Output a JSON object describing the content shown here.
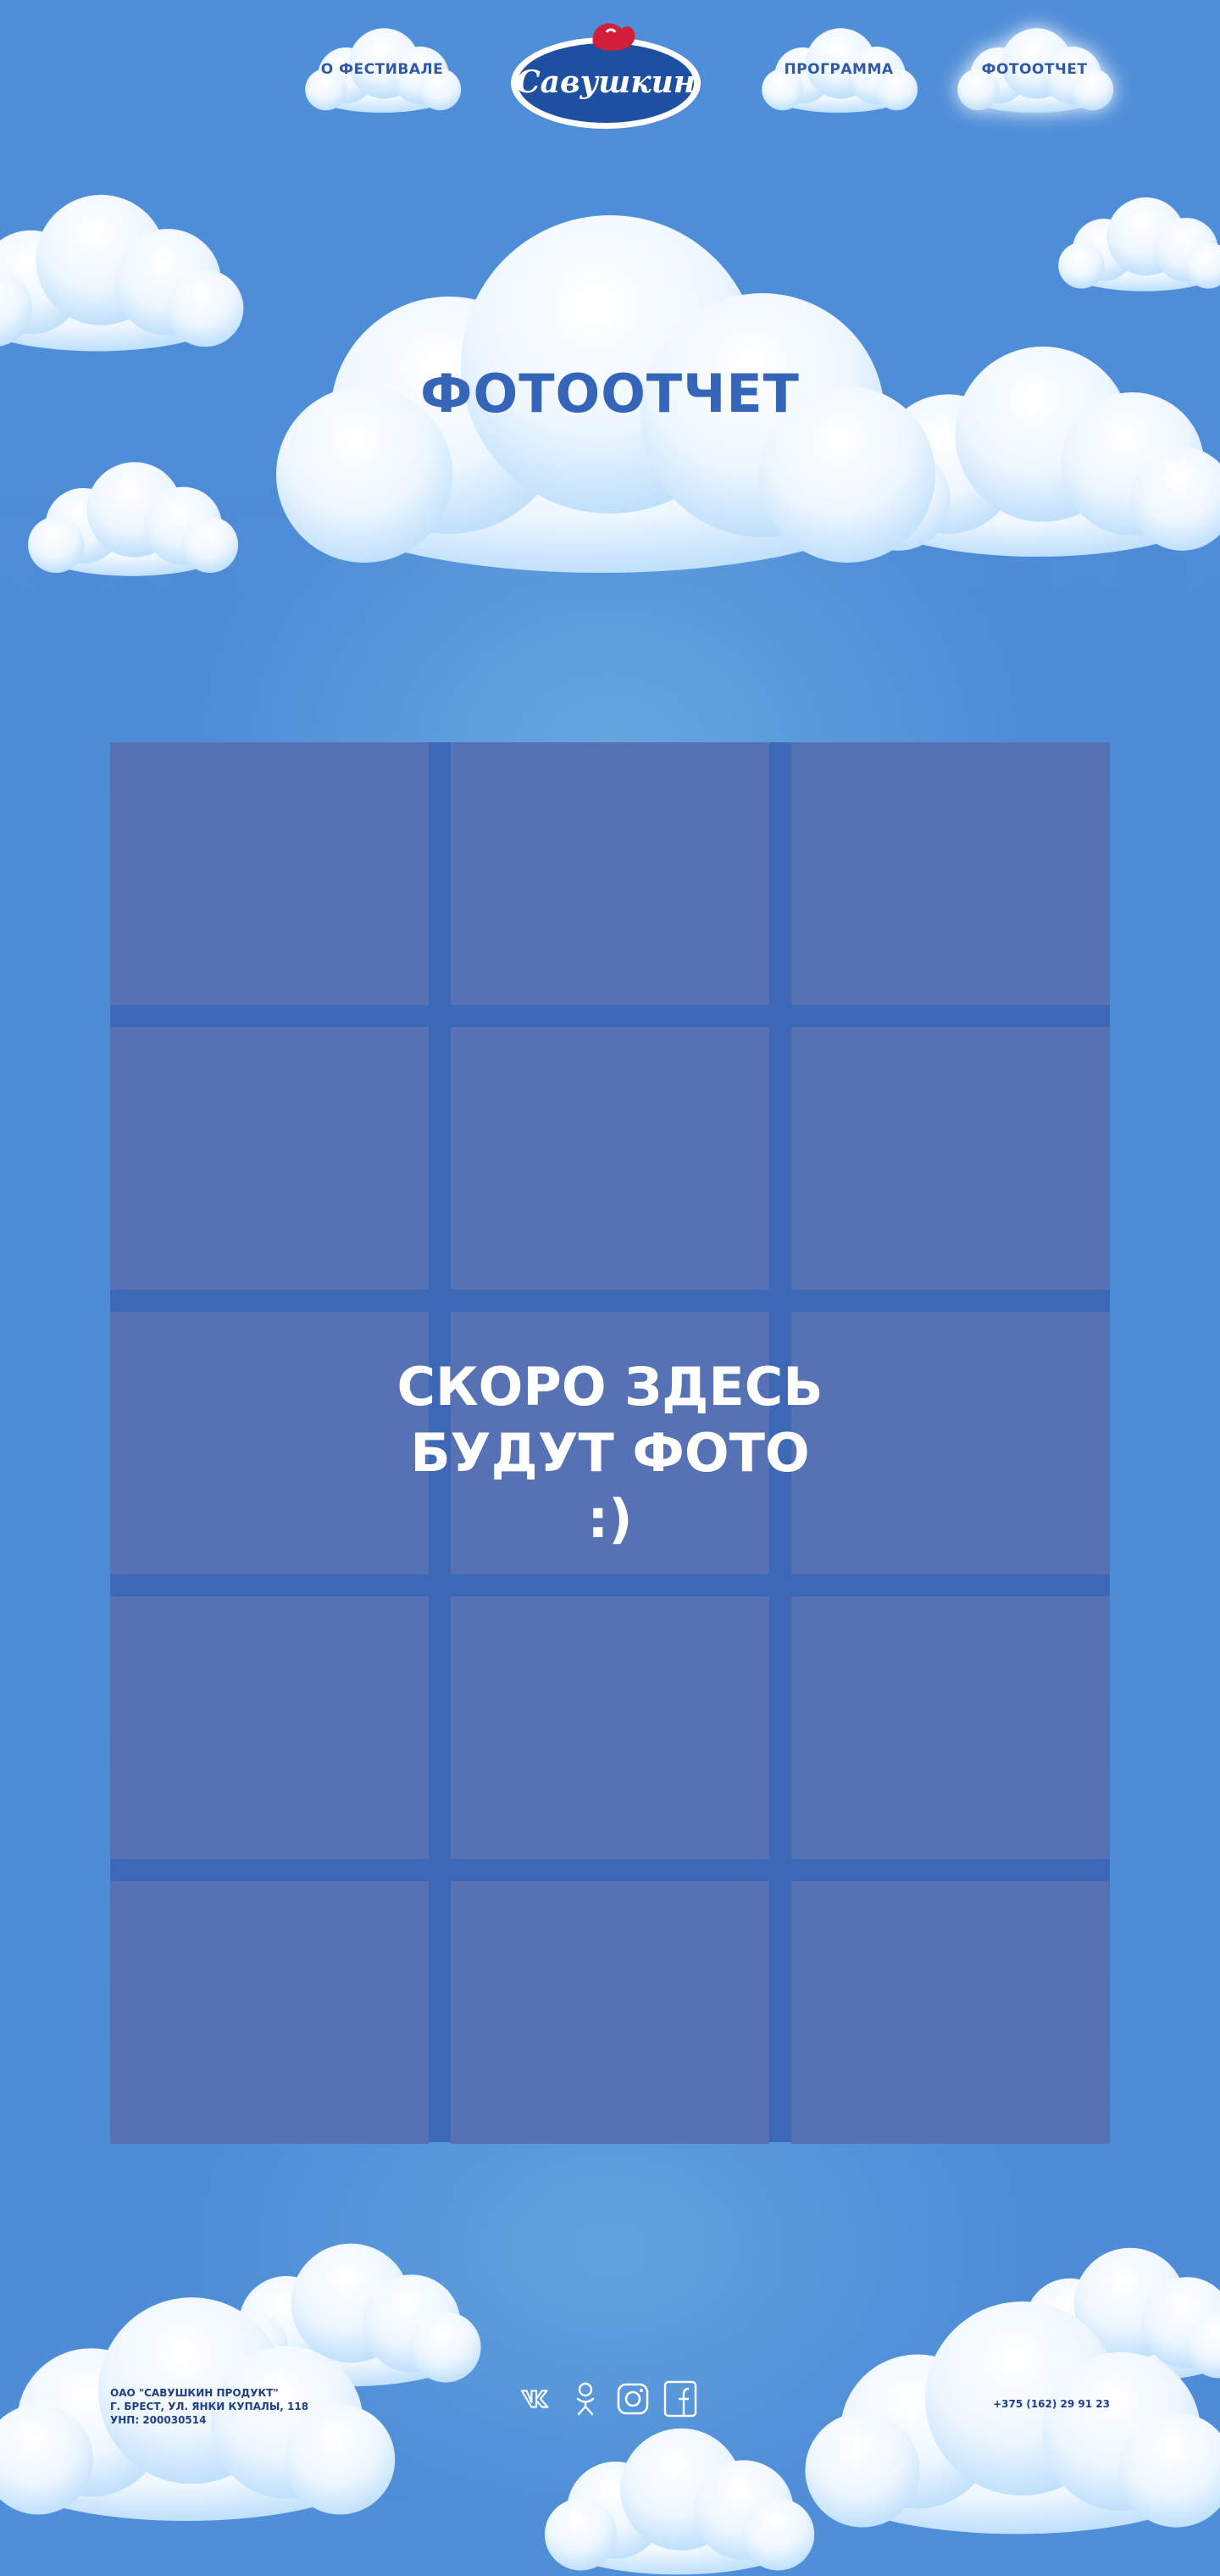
{
  "nav": {
    "about": "О ФЕСТИВАЛЕ",
    "program": "ПРОГРАММА",
    "photos": "ФОТООТЧЕТ"
  },
  "logo": {
    "text": "Савушкин"
  },
  "page": {
    "title": "ФОТООТЧЕТ",
    "placeholder": "СКОРО ЗДЕСЬ\nБУДУТ ФОТО\n:)"
  },
  "footer": {
    "company": "ОАО \"САВУШКИН ПРОДУКТ\"",
    "address": "Г. БРЕСТ, УЛ. ЯНКИ КУПАЛЫ, 118",
    "unp": "УНП: 200030514",
    "phone": "+375 (162) 29 91 23"
  },
  "colors": {
    "accent_blue": "#3565b8",
    "cell": "#5672b4",
    "logo_blue": "#1e4fa0",
    "logo_red": "#d21e3a"
  }
}
